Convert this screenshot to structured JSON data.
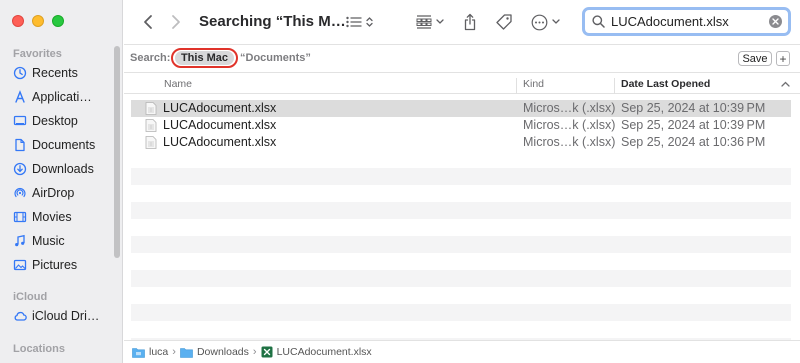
{
  "window": {
    "title": "Searching “This M…",
    "traffic_lights": [
      "close",
      "minimize",
      "zoom"
    ]
  },
  "sidebar": {
    "sections": [
      {
        "heading": "Favorites",
        "items": [
          {
            "label": "Recents",
            "icon": "clock-icon"
          },
          {
            "label": "Applicati…",
            "icon": "applications-icon"
          },
          {
            "label": "Desktop",
            "icon": "desktop-icon"
          },
          {
            "label": "Documents",
            "icon": "document-icon"
          },
          {
            "label": "Downloads",
            "icon": "downloads-icon"
          },
          {
            "label": "AirDrop",
            "icon": "airdrop-icon"
          },
          {
            "label": "Movies",
            "icon": "movies-icon"
          },
          {
            "label": "Music",
            "icon": "music-icon"
          },
          {
            "label": "Pictures",
            "icon": "pictures-icon"
          }
        ]
      },
      {
        "heading": "iCloud",
        "items": [
          {
            "label": "iCloud Dri…",
            "icon": "cloud-icon"
          }
        ]
      },
      {
        "heading": "Locations",
        "items": []
      }
    ]
  },
  "search": {
    "value": "LUCAdocument.xlsx",
    "scope_label": "Search:",
    "scope_active": "This Mac",
    "scope_other": "“Documents”",
    "save_label": "Save",
    "add_label": "+"
  },
  "columns": {
    "name": "Name",
    "kind": "Kind",
    "date": "Date Last Opened"
  },
  "files": [
    {
      "name": "LUCAdocument.xlsx",
      "kind": "Micros…k (.xlsx)",
      "date": "Sep 25, 2024 at 10:39 PM",
      "selected": true
    },
    {
      "name": "LUCAdocument.xlsx",
      "kind": "Micros…k (.xlsx)",
      "date": "Sep 25, 2024 at 10:39 PM",
      "selected": false
    },
    {
      "name": "LUCAdocument.xlsx",
      "kind": "Micros…k (.xlsx)",
      "date": "Sep 25, 2024 at 10:36 PM",
      "selected": false
    }
  ],
  "path_bar": [
    "luca",
    "Downloads",
    "LUCAdocument.xlsx"
  ],
  "colors": {
    "accent": "#3478f6",
    "selection": "#dcdcdc",
    "scope_highlight": "#e0332a",
    "sidebar_bg": "#eeeef0",
    "excel_green": "#1f7244"
  }
}
